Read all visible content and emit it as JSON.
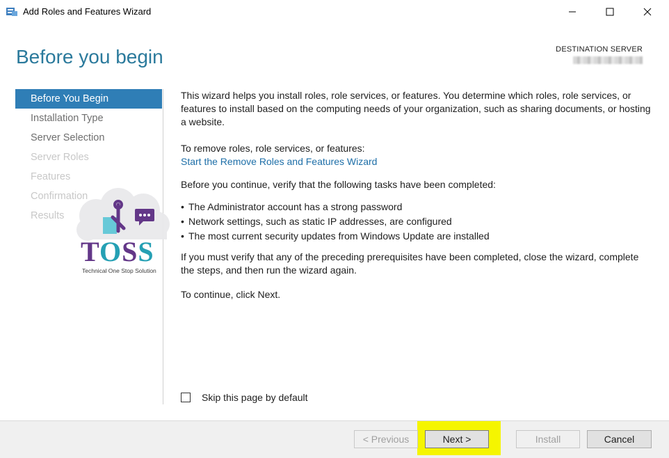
{
  "window": {
    "title": "Add Roles and Features Wizard",
    "controls": [
      "minimize-icon",
      "maximize-icon",
      "close-icon"
    ]
  },
  "header": {
    "heading": "Before you begin",
    "destination_label": "DESTINATION SERVER"
  },
  "sidebar": {
    "items": [
      {
        "label": "Before You Begin",
        "state": "active"
      },
      {
        "label": "Installation Type",
        "state": "enabled"
      },
      {
        "label": "Server Selection",
        "state": "enabled"
      },
      {
        "label": "Server Roles",
        "state": "disabled"
      },
      {
        "label": "Features",
        "state": "disabled"
      },
      {
        "label": "Confirmation",
        "state": "disabled"
      },
      {
        "label": "Results",
        "state": "disabled"
      }
    ]
  },
  "content": {
    "intro": "This wizard helps you install roles, role services, or features. You determine which roles, role services, or features to install based on the computing needs of your organization, such as sharing documents, or hosting a website.",
    "remove_label": "To remove roles, role services, or features:",
    "remove_link": "Start the Remove Roles and Features Wizard",
    "verify_intro": "Before you continue, verify that the following tasks have been completed:",
    "bullets": [
      "The Administrator account has a strong password",
      "Network settings, such as static IP addresses, are configured",
      "The most current security updates from Windows Update are installed"
    ],
    "prereq_note": "If you must verify that any of the preceding prerequisites have been completed, close the wizard, complete the steps, and then run the wizard again.",
    "continue_note": "To continue, click Next."
  },
  "skip": {
    "label": "Skip this page by default",
    "checked": false
  },
  "footer": {
    "previous": "< Previous",
    "next": "Next >",
    "install": "Install",
    "cancel": "Cancel"
  },
  "watermark": {
    "name": "TOSS",
    "tagline": "Technical One Stop Solution"
  },
  "colors": {
    "accent": "#2f7eb6",
    "heading": "#2b7a9c",
    "highlight": "#f5f500",
    "logo_purple": "#5b2d82",
    "logo_teal": "#1a9bb0"
  }
}
